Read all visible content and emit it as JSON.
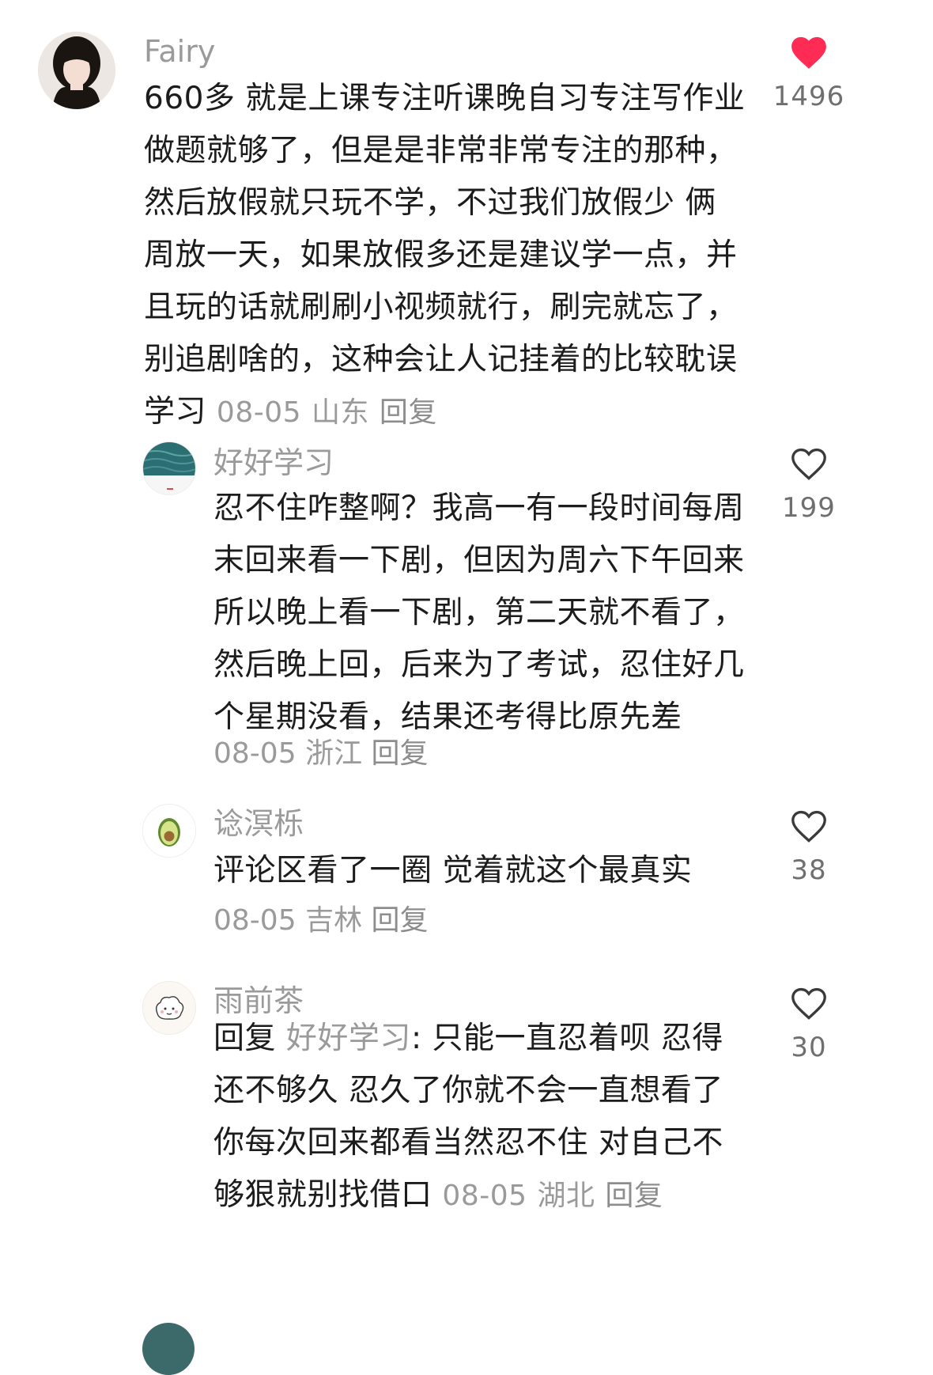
{
  "comments": [
    {
      "user": "Fairy",
      "lines": [
        "660多 就是上课专注听课晚自习专注写作业",
        "做题就够了，但是是非常非常专注的那种，",
        "然后放假就只玩不学，不过我们放假少 俩",
        "周放一天，如果放假多还是建议学一点，并",
        "且玩的话就刷刷小视频就行，刷完就忘了，"
      ],
      "lines2": [
        "别追剧啥的，这种会让人记挂着的比较耽误",
        "学习"
      ],
      "date": "08-05",
      "location": "山东",
      "reply": "回复",
      "likes": "1496",
      "liked": true
    },
    {
      "user": "好好学习",
      "lines": [
        "忍不住咋整啊？我高一有一段时间每周",
        "末回来看一下剧，但因为周六下午回来",
        "所以晚上看一下剧，第二天就不看了，",
        "然后晚上回，后来为了考试，忍住好几",
        "个星期没看，结果还考得比原先差"
      ],
      "date": "08-05",
      "location": "浙江",
      "reply": "回复",
      "likes": "199",
      "liked": false
    },
    {
      "user": "谂溟栎",
      "lines": [
        "评论区看了一圈 觉着就这个最真实"
      ],
      "date": "08-05",
      "location": "吉林",
      "reply": "回复",
      "likes": "38",
      "liked": false
    },
    {
      "user": "雨前茶",
      "reply_prefix": "回复",
      "reply_to": "好好学习",
      "first_line_rest": ": 只能一直忍着呗 忍得",
      "lines": [
        "还不够久 忍久了你就不会一直想看了",
        "你每次回来都看当然忍不住 对自己不"
      ],
      "last_line": "够狠就别找借口",
      "date": "08-05",
      "location": "湖北",
      "reply": "回复",
      "likes": "30",
      "liked": false
    }
  ],
  "colors": {
    "liked_heart": "#fe2c55",
    "muted_text": "#9a9a9a",
    "body_text": "#1c1c1c"
  }
}
